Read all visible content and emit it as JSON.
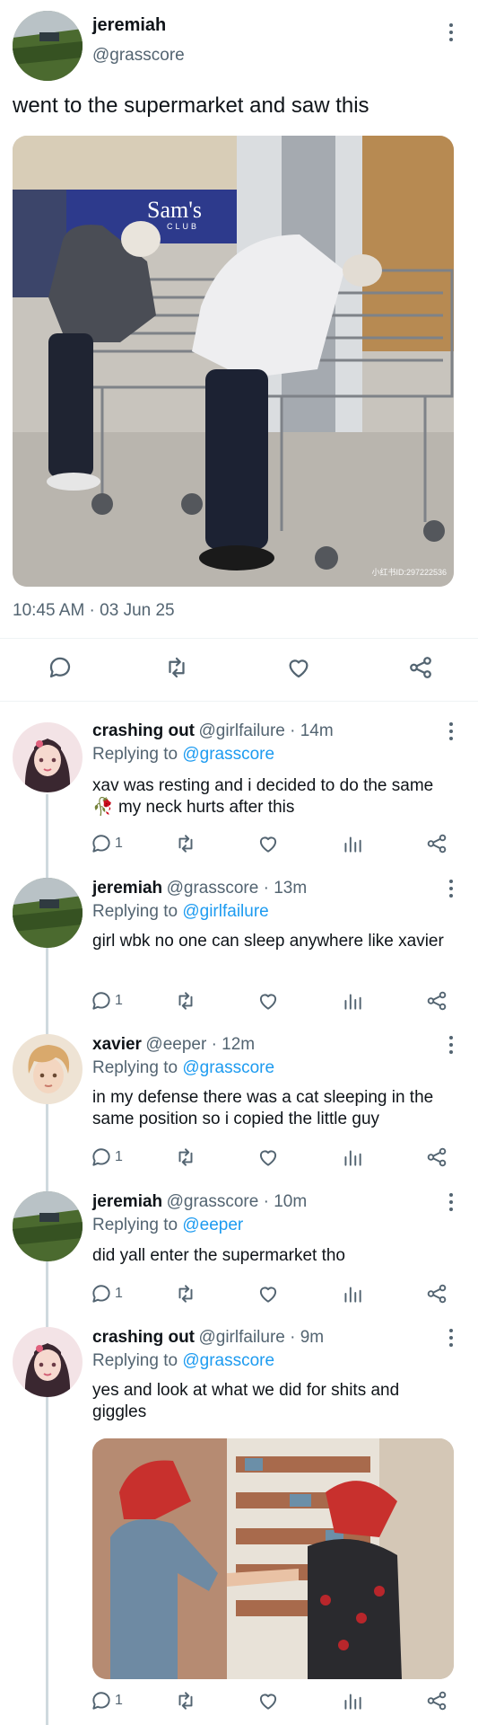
{
  "main_tweet": {
    "author_name": "jeremiah",
    "author_handle": "@grasscore",
    "text": "went to the supermarket and saw this",
    "image_sign_text": "Sam's",
    "image_sign_sub": "CLUB",
    "image_watermark": "小红书ID:297222536",
    "timestamp": "10:45 AM · 03 Jun 25"
  },
  "replies": [
    {
      "author_name": "crashing out",
      "meta": "@girlfailure · 14m",
      "replying_prefix": "Replying to ",
      "replying_to": "@grasscore",
      "text_before": "xav was resting and i decided to do the same",
      "text_emoji": "🥀",
      "text_after": " my neck hurts after this",
      "reply_count": "1"
    },
    {
      "author_name": "jeremiah",
      "meta": "@grasscore · 13m",
      "replying_prefix": "Replying to ",
      "replying_to": "@girlfailure",
      "text": "girl wbk no one can sleep anywhere like xavier",
      "reply_count": "1"
    },
    {
      "author_name": "xavier",
      "meta": "@eeper · 12m",
      "replying_prefix": "Replying to ",
      "replying_to": "@grasscore",
      "text": "in my defense there was a cat sleeping in the same position so i copied the little guy",
      "reply_count": "1"
    },
    {
      "author_name": "jeremiah",
      "meta": "@grasscore · 10m",
      "replying_prefix": "Replying to ",
      "replying_to": "@eeper",
      "text": "did yall enter the supermarket tho",
      "reply_count": "1"
    },
    {
      "author_name": "crashing out",
      "meta": "@girlfailure · 9m",
      "replying_prefix": "Replying to ",
      "replying_to": "@grasscore",
      "text": "yes and look at what we did for shits and giggles",
      "reply_count": "1"
    }
  ],
  "colors": {
    "accent": "#1d9bf0",
    "muted": "#536471",
    "text": "#0f1419",
    "thread_line": "#cfd9de"
  },
  "icons": [
    "more-icon",
    "reply-icon",
    "retweet-icon",
    "like-icon",
    "views-icon",
    "share-icon"
  ]
}
